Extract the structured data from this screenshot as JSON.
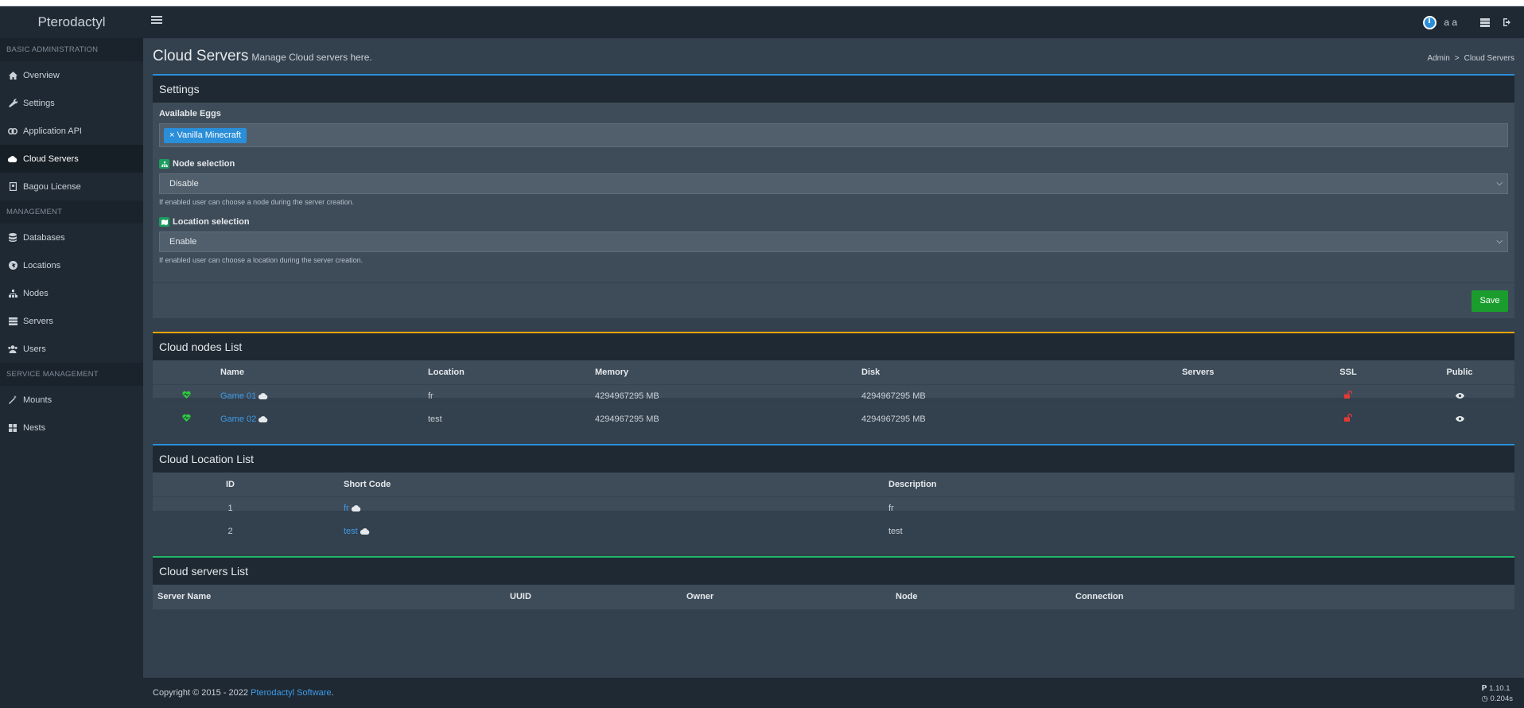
{
  "header": {
    "logo": "Pterodactyl",
    "user_name": "a a",
    "icons": [
      "menu-icon",
      "power-avatar-icon",
      "server-list-icon",
      "logout-icon"
    ]
  },
  "sidebar": {
    "sections": [
      {
        "title": "BASIC ADMINISTRATION",
        "items": [
          {
            "label": "Overview",
            "icon": "home-icon"
          },
          {
            "label": "Settings",
            "icon": "wrench-icon"
          },
          {
            "label": "Application API",
            "icon": "link-icon"
          },
          {
            "label": "Cloud Servers",
            "icon": "cloud-icon",
            "active": true
          },
          {
            "label": "Bagou License",
            "icon": "license-icon"
          }
        ]
      },
      {
        "title": "MANAGEMENT",
        "items": [
          {
            "label": "Databases",
            "icon": "database-icon"
          },
          {
            "label": "Locations",
            "icon": "globe-icon"
          },
          {
            "label": "Nodes",
            "icon": "sitemap-icon"
          },
          {
            "label": "Servers",
            "icon": "server-icon"
          },
          {
            "label": "Users",
            "icon": "users-icon"
          }
        ]
      },
      {
        "title": "SERVICE MANAGEMENT",
        "items": [
          {
            "label": "Mounts",
            "icon": "magic-icon"
          },
          {
            "label": "Nests",
            "icon": "th-large-icon"
          }
        ]
      }
    ]
  },
  "page": {
    "title": "Cloud Servers",
    "subtitle": "Manage Cloud servers here.",
    "breadcrumb": [
      "Admin",
      "Cloud Servers"
    ]
  },
  "settings": {
    "title": "Settings",
    "eggs_label": "Available Eggs",
    "eggs": [
      {
        "remove": "×",
        "label": "Vanilla Minecraft"
      }
    ],
    "node_selection": {
      "label": "Node selection",
      "value": "Disable",
      "help": "If enabled user can choose a node during the server creation."
    },
    "location_selection": {
      "label": "Location selection",
      "value": "Enable",
      "help": "If enabled user can choose a location during the server creation."
    },
    "save_label": "Save"
  },
  "nodes": {
    "title": "Cloud nodes List",
    "columns": [
      "",
      "Name",
      "Location",
      "Memory",
      "Disk",
      "Servers",
      "SSL",
      "Public"
    ],
    "rows": [
      {
        "name": "Game 01",
        "location": "fr",
        "memory": "4294967295 MB",
        "disk": "4294967295 MB",
        "servers": ""
      },
      {
        "name": "Game 02",
        "location": "test",
        "memory": "4294967295 MB",
        "disk": "4294967295 MB",
        "servers": ""
      }
    ]
  },
  "locations": {
    "title": "Cloud Location List",
    "columns": [
      "ID",
      "Short Code",
      "Description"
    ],
    "rows": [
      {
        "id": "1",
        "short": "fr",
        "desc": "fr"
      },
      {
        "id": "2",
        "short": "test",
        "desc": "test"
      }
    ]
  },
  "servers": {
    "title": "Cloud servers List",
    "columns": [
      "Server Name",
      "UUID",
      "Owner",
      "Node",
      "Connection"
    ]
  },
  "footer": {
    "copyright": "Copyright © 2015 - 2022",
    "brand_link": "Pterodactyl Software",
    "period": ".",
    "version": "1.10.1",
    "time": "0.204s"
  },
  "colors": {
    "accent_blue": "#2a8ed9",
    "accent_orange": "#f0a500",
    "accent_green": "#1db968",
    "save_green": "#1a9d2d",
    "sidebar": "#1f2933"
  }
}
